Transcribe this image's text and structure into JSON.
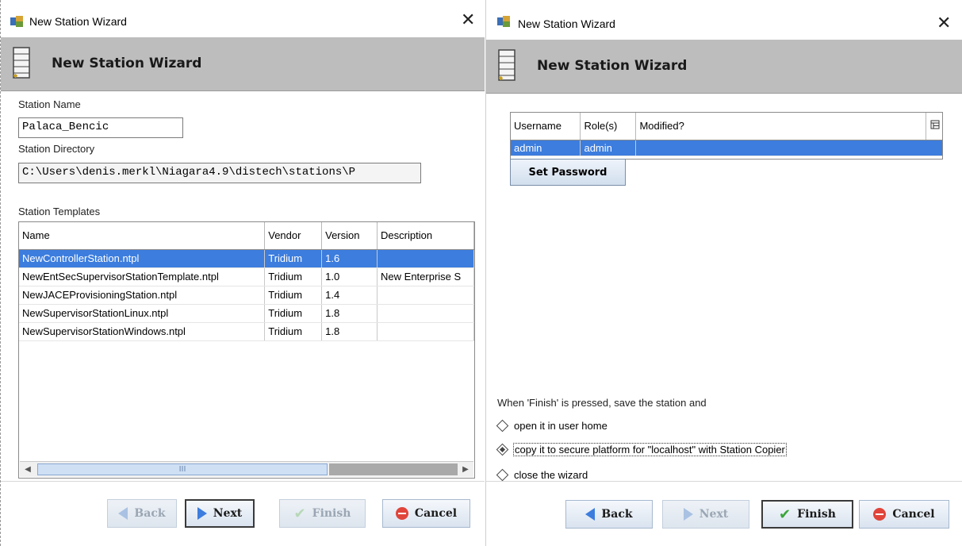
{
  "left": {
    "window_title": "New Station Wizard",
    "header_title": "New Station Wizard",
    "station_name_label": "Station Name",
    "station_name_value": "Palaca_Bencic",
    "station_dir_label": "Station Directory",
    "station_dir_value": "C:\\Users\\denis.merkl\\Niagara4.9\\distech\\stations\\P",
    "templates_label": "Station Templates",
    "columns": [
      "Name",
      "Vendor",
      "Version",
      "Description"
    ],
    "rows": [
      {
        "name": "NewControllerStation.ntpl",
        "vendor": "Tridium",
        "version": "1.6",
        "description": ""
      },
      {
        "name": "NewEntSecSupervisorStationTemplate.ntpl",
        "vendor": "Tridium",
        "version": "1.0",
        "description": "New Enterprise S"
      },
      {
        "name": "NewJACEProvisioningStation.ntpl",
        "vendor": "Tridium",
        "version": "1.4",
        "description": ""
      },
      {
        "name": "NewSupervisorStationLinux.ntpl",
        "vendor": "Tridium",
        "version": "1.8",
        "description": ""
      },
      {
        "name": "NewSupervisorStationWindows.ntpl",
        "vendor": "Tridium",
        "version": "1.8",
        "description": ""
      }
    ],
    "scroll_grip": "III",
    "buttons": {
      "back": "Back",
      "next": "Next",
      "finish": "Finish",
      "cancel": "Cancel"
    }
  },
  "right": {
    "window_title": "New Station Wizard",
    "header_title": "New Station Wizard",
    "columns": [
      "Username",
      "Role(s)",
      "Modified?"
    ],
    "rows": [
      {
        "username": "admin",
        "roles": "admin",
        "modified": ""
      }
    ],
    "set_password": "Set Password",
    "finish_prompt": "When 'Finish' is pressed, save the station and",
    "options": [
      {
        "label": "open it in user home",
        "selected": false
      },
      {
        "label": "copy it to secure platform for \"localhost\" with Station Copier",
        "selected": true
      },
      {
        "label": "close the wizard",
        "selected": false
      }
    ],
    "buttons": {
      "back": "Back",
      "next": "Next",
      "finish": "Finish",
      "cancel": "Cancel"
    }
  },
  "icons": {
    "app": "niagara-app-icon",
    "header": "station-server-icon",
    "close": "close-icon",
    "column_chooser": "table-options-icon"
  },
  "colors": {
    "selection": "#3c7dde",
    "header_band": "#bdbdbd",
    "accent_arrow": "#3c7dde",
    "cancel_red": "#e0443a",
    "finish_green": "#3aa53a"
  }
}
